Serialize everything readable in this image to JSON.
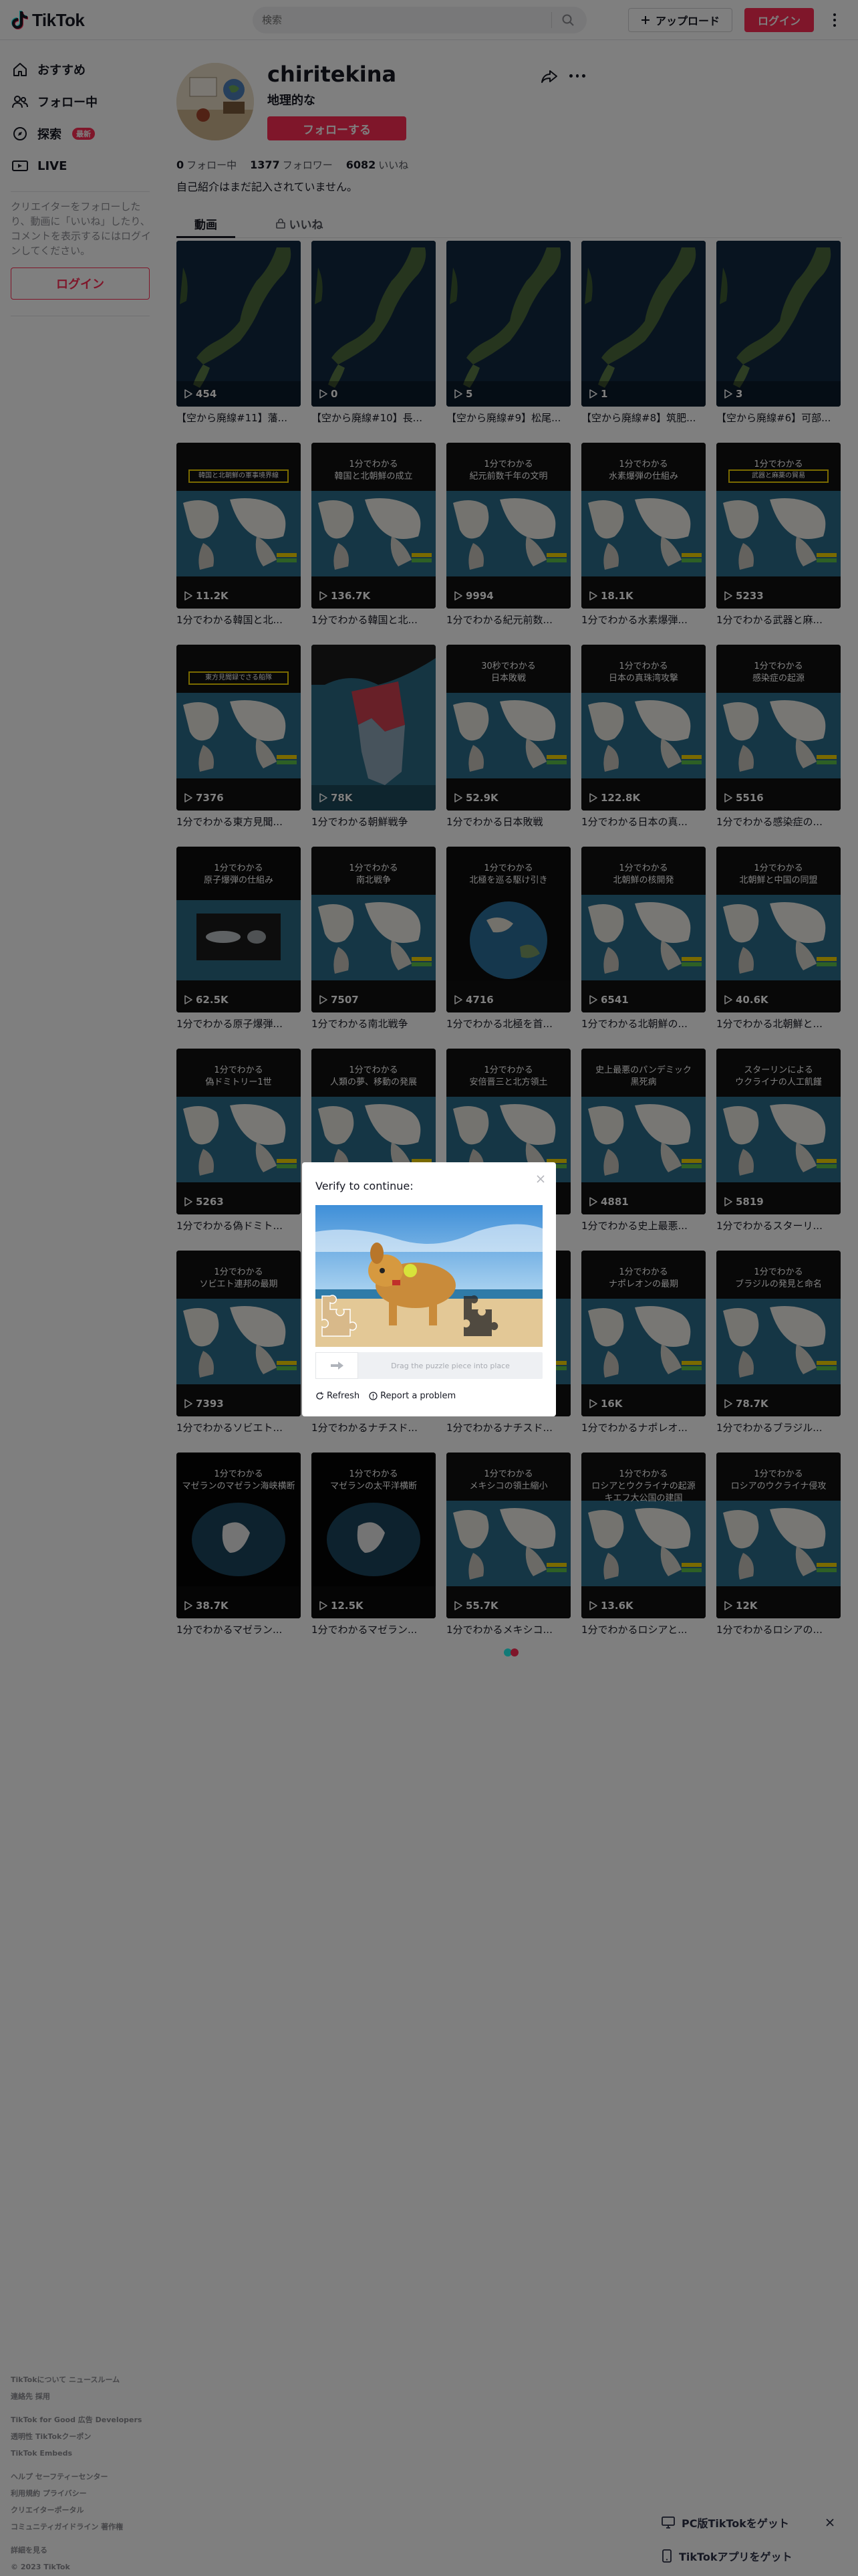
{
  "header": {
    "logo_text": "TikTok",
    "search_placeholder": "検索",
    "upload_label": "アップロード",
    "login_label": "ログイン"
  },
  "sidebar": {
    "items": [
      {
        "label": "おすすめ",
        "icon": "home-icon"
      },
      {
        "label": "フォロー中",
        "icon": "following-icon"
      },
      {
        "label": "探索",
        "icon": "compass-icon",
        "badge": "最新"
      },
      {
        "label": "LIVE",
        "icon": "live-icon"
      }
    ],
    "prompt": "クリエイターをフォローしたり、動画に「いいね」したり、コメントを表示するにはログインしてください。",
    "login_label": "ログイン",
    "footer": [
      "TikTokについて  ニュースルーム",
      "連絡先  採用",
      "",
      "TikTok for Good  広告  Developers",
      "透明性  TikTokクーポン",
      "TikTok Embeds",
      "",
      "ヘルプ  セーフティーセンター",
      "利用規約  プライバシー",
      "クリエイターポータル",
      "コミュニティガイドライン  著作権",
      "",
      "詳細を見る",
      "© 2023 TikTok"
    ]
  },
  "profile": {
    "username": "chiritekina",
    "nickname": "地理的な",
    "follow_label": "フォローする",
    "following_count": "0",
    "following_label": "フォロー中",
    "followers_count": "1377",
    "followers_label": "フォロワー",
    "likes_count": "6082",
    "likes_label": "いいね",
    "bio": "自己紹介はまだ記入されていません。"
  },
  "tabs": {
    "videos": "動画",
    "liked": "いいね"
  },
  "videos": [
    {
      "views": "454",
      "caption": "【空から廃線#11】藩...",
      "kind": "satellite",
      "title": ""
    },
    {
      "views": "0",
      "caption": "【空から廃線#10】長...",
      "kind": "satellite",
      "title": ""
    },
    {
      "views": "5",
      "caption": "【空から廃線#9】松尾...",
      "kind": "satellite",
      "title": ""
    },
    {
      "views": "1",
      "caption": "【空から廃線#8】筑肥...",
      "kind": "satellite",
      "title": ""
    },
    {
      "views": "3",
      "caption": "【空から廃線#6】可部...",
      "kind": "satellite",
      "title": ""
    },
    {
      "views": "11.2K",
      "caption": "1分でわかる韓国と北...",
      "kind": "map",
      "title": "",
      "banner": "韓国と北朝鮮の軍事境界線"
    },
    {
      "views": "136.7K",
      "caption": "1分でわかる韓国と北...",
      "kind": "map",
      "title": "1分でわかる\n韓国と北朝鮮の成立"
    },
    {
      "views": "9994",
      "caption": "1分でわかる紀元前数...",
      "kind": "map",
      "title": "1分でわかる\n紀元前数千年の文明"
    },
    {
      "views": "18.1K",
      "caption": "1分でわかる水素爆弾...",
      "kind": "map",
      "title": "1分でわかる\n水素爆弾の仕組み"
    },
    {
      "views": "5233",
      "caption": "1分でわかる武器と麻...",
      "kind": "map",
      "title": "1分でわかる\n武器と麻薬の貿易",
      "banner": "武器と麻薬の貿易"
    },
    {
      "views": "7376",
      "caption": "1分でわかる東方見聞...",
      "kind": "map",
      "title": "",
      "banner": "東方見聞録でさる船隊"
    },
    {
      "views": "78K",
      "caption": "1分でわかる朝鮮戦争",
      "kind": "korea",
      "title": ""
    },
    {
      "views": "52.9K",
      "caption": "1分でわかる日本敗戦",
      "kind": "map",
      "title": "30秒でわかる\n日本敗戦"
    },
    {
      "views": "122.8K",
      "caption": "1分でわかる日本の真...",
      "kind": "map",
      "title": "1分でわかる\n日本の真珠湾攻撃"
    },
    {
      "views": "5516",
      "caption": "1分でわかる感染症の...",
      "kind": "map",
      "title": "1分でわかる\n感染症の起源"
    },
    {
      "views": "62.5K",
      "caption": "1分でわかる原子爆弾...",
      "kind": "bomb",
      "title": "1分でわかる\n原子爆弾の仕組み"
    },
    {
      "views": "7507",
      "caption": "1分でわかる南北戦争",
      "kind": "map",
      "title": "1分でわかる\n南北戦争"
    },
    {
      "views": "4716",
      "caption": "1分でわかる北極を首...",
      "kind": "globe",
      "title": "1分でわかる\n北極を巡る駆け引き"
    },
    {
      "views": "6541",
      "caption": "1分でわかる北朝鮮の...",
      "kind": "map",
      "title": "1分でわかる\n北朝鮮の核開発"
    },
    {
      "views": "40.6K",
      "caption": "1分でわかる北朝鮮と...",
      "kind": "map",
      "title": "1分でわかる\n北朝鮮と中国の同盟"
    },
    {
      "views": "5263",
      "caption": "1分でわかる偽ドミト...",
      "kind": "map",
      "title": "1分でわかる\n偽ドミトリー1世"
    },
    {
      "views": "",
      "caption": "",
      "kind": "map",
      "title": "1分でわかる\n人類の夢、移動の発展"
    },
    {
      "views": "",
      "caption": "",
      "kind": "map",
      "title": "1分でわかる\n安倍晋三と北方領土"
    },
    {
      "views": "4881",
      "caption": "1分でわかる史上最悪...",
      "kind": "map",
      "title": "史上最悪のパンデミック\n黒死病"
    },
    {
      "views": "5819",
      "caption": "1分でわかるスターリ...",
      "kind": "map",
      "title": "スターリンによる\nウクライナの人工飢饉"
    },
    {
      "views": "7393",
      "caption": "1分でわかるソビエト...",
      "kind": "map",
      "title": "1分でわかる\nソビエト連邦の最期"
    },
    {
      "views": "",
      "caption": "1分でわかるナチスド...",
      "kind": "map",
      "title": ""
    },
    {
      "views": "",
      "caption": "1分でわかるナチスド...",
      "kind": "map",
      "title": ""
    },
    {
      "views": "16K",
      "caption": "1分でわかるナポレオ...",
      "kind": "map",
      "title": "1分でわかる\nナポレオンの最期"
    },
    {
      "views": "78.7K",
      "caption": "1分でわかるブラジル...",
      "kind": "map",
      "title": "1分でわかる\nブラジルの発見と命名"
    },
    {
      "views": "38.7K",
      "caption": "1分でわかるマゼラン...",
      "kind": "dark",
      "title": "1分でわかる\nマゼランのマゼラン海峡横断"
    },
    {
      "views": "12.5K",
      "caption": "1分でわかるマゼラン...",
      "kind": "dark",
      "title": "1分でわかる\nマゼランの太平洋横断"
    },
    {
      "views": "55.7K",
      "caption": "1分でわかるメキシコ...",
      "kind": "map",
      "title": "1分でわかる\nメキシコの領土縮小"
    },
    {
      "views": "13.6K",
      "caption": "1分でわかるロシアと...",
      "kind": "map",
      "title": "1分でわかる\nロシアとウクライナの起源\nキエフ大公国の建国"
    },
    {
      "views": "12K",
      "caption": "1分でわかるロシアの...",
      "kind": "map",
      "title": "1分でわかる\nロシアのウクライナ侵攻"
    }
  ],
  "captcha": {
    "title": "Verify to continue:",
    "slider_text": "Drag the puzzle piece into place",
    "refresh_label": "Refresh",
    "report_label": "Report a problem"
  },
  "banners": {
    "pc": "PC版TikTokをゲット",
    "app": "TikTokアプリをゲット"
  },
  "colors": {
    "accent": "#fe2c55",
    "text": "#161823",
    "overlay": "rgba(0,0,0,0.5)"
  }
}
